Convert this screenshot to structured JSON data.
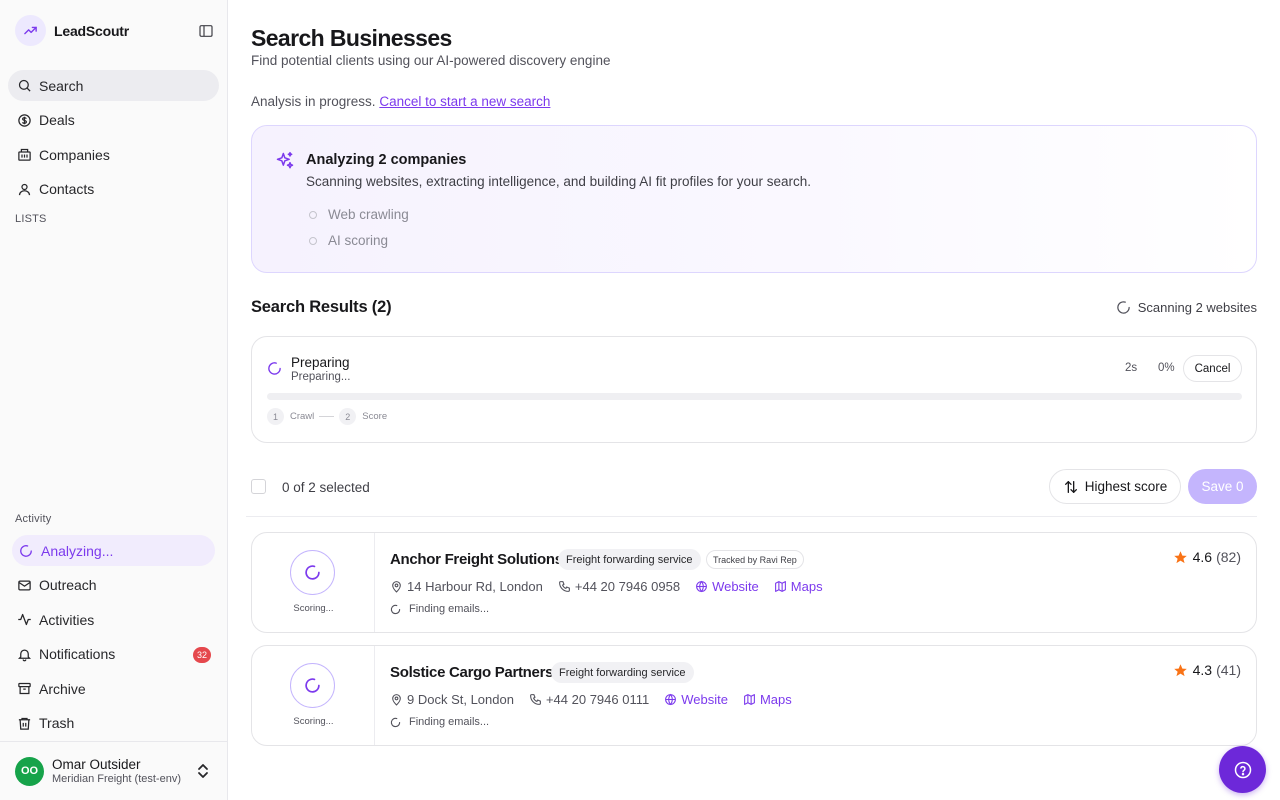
{
  "app": {
    "name": "LeadScoutr"
  },
  "sidebar": {
    "nav": [
      {
        "label": "Search",
        "icon": "search-icon",
        "active": true
      },
      {
        "label": "Deals",
        "icon": "dollar-icon"
      },
      {
        "label": "Companies",
        "icon": "building-icon"
      },
      {
        "label": "Contacts",
        "icon": "user-icon"
      }
    ],
    "lists_label": "LISTS",
    "activity_label": "Activity",
    "activity": [
      {
        "label": "Analyzing...",
        "icon": "spinner-icon"
      },
      {
        "label": "Outreach",
        "icon": "mail-icon"
      },
      {
        "label": "Activities",
        "icon": "activity-icon"
      },
      {
        "label": "Notifications",
        "icon": "bell-icon",
        "badge": "32"
      },
      {
        "label": "Archive",
        "icon": "archive-icon"
      },
      {
        "label": "Trash",
        "icon": "trash-icon"
      }
    ],
    "user": {
      "initials": "OO",
      "name": "Omar Outsider",
      "org": "Meridian Freight (test-env)"
    }
  },
  "page": {
    "title": "Search Businesses",
    "subtitle": "Find potential clients using our AI-powered discovery engine",
    "progress_text": "Analysis in progress.",
    "cancel_link": "Cancel to start a new search"
  },
  "analysis": {
    "title": "Analyzing 2 companies",
    "description": "Scanning websites, extracting intelligence, and building AI fit profiles for your search.",
    "steps": [
      "Web crawling",
      "AI scoring"
    ]
  },
  "results": {
    "title": "Search Results (2)",
    "scan_status": "Scanning 2 websites"
  },
  "preparing": {
    "title": "Preparing",
    "subtitle": "Preparing...",
    "elapsed": "2s",
    "percent_label": "0%",
    "progress": 0,
    "cancel_label": "Cancel",
    "phases": [
      {
        "num": "1",
        "label": "Crawl"
      },
      {
        "num": "2",
        "label": "Score"
      }
    ]
  },
  "toolbar": {
    "selected": "0 of 2 selected",
    "sort_label": "Highest score",
    "save_label": "Save 0"
  },
  "companies": [
    {
      "name": "Anchor Freight Solutions",
      "tag": "Freight forwarding service",
      "tracked": "Tracked by Ravi Rep",
      "rating": "4.6",
      "reviews": "(82)",
      "address": "14 Harbour Rd, London",
      "phone": "+44 20 7946 0958",
      "website": "Website",
      "maps": "Maps",
      "email_status": "Finding emails...",
      "score_status": "Scoring..."
    },
    {
      "name": "Solstice Cargo Partners",
      "tag": "Freight forwarding service",
      "rating": "4.3",
      "reviews": "(41)",
      "address": "9 Dock St, London",
      "phone": "+44 20 7946 0111",
      "website": "Website",
      "maps": "Maps",
      "email_status": "Finding emails...",
      "score_status": "Scoring..."
    }
  ],
  "colors": {
    "accent": "#7c3aed",
    "badge": "#e5484d",
    "star": "#f97316",
    "avatar": "#16a34a"
  }
}
